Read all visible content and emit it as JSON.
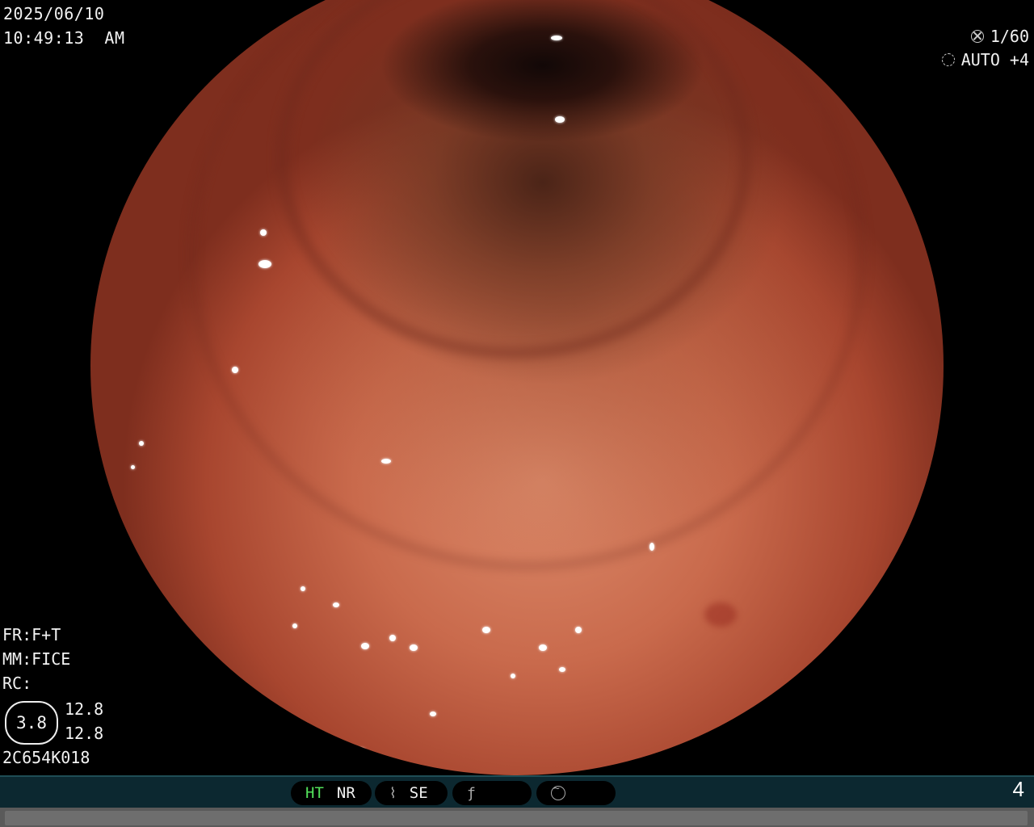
{
  "timestamp": {
    "date": "2025/06/10",
    "time": "10:49:13  AM"
  },
  "camera": {
    "shutter_icon": "shutter-icon",
    "shutter": "1/60",
    "auto_icon": "aperture-icon",
    "auto": "AUTO +4"
  },
  "settings": {
    "fr": "FR:F+T",
    "mm": "MM:FICE",
    "rc": "RC:",
    "gauge_value": "3.8",
    "value_1": "12.8",
    "value_2": "12.8",
    "serial": "2C654K018"
  },
  "toolbar": {
    "ht": "HT",
    "nr": "NR",
    "se_icon": "scope-icon",
    "se": "SE",
    "filter_icon": "function-icon",
    "wave_icon": "wave-circle-icon",
    "page": "4"
  },
  "colors": {
    "ht_active": "#52e05a",
    "bar_bg": "#0c2830"
  }
}
